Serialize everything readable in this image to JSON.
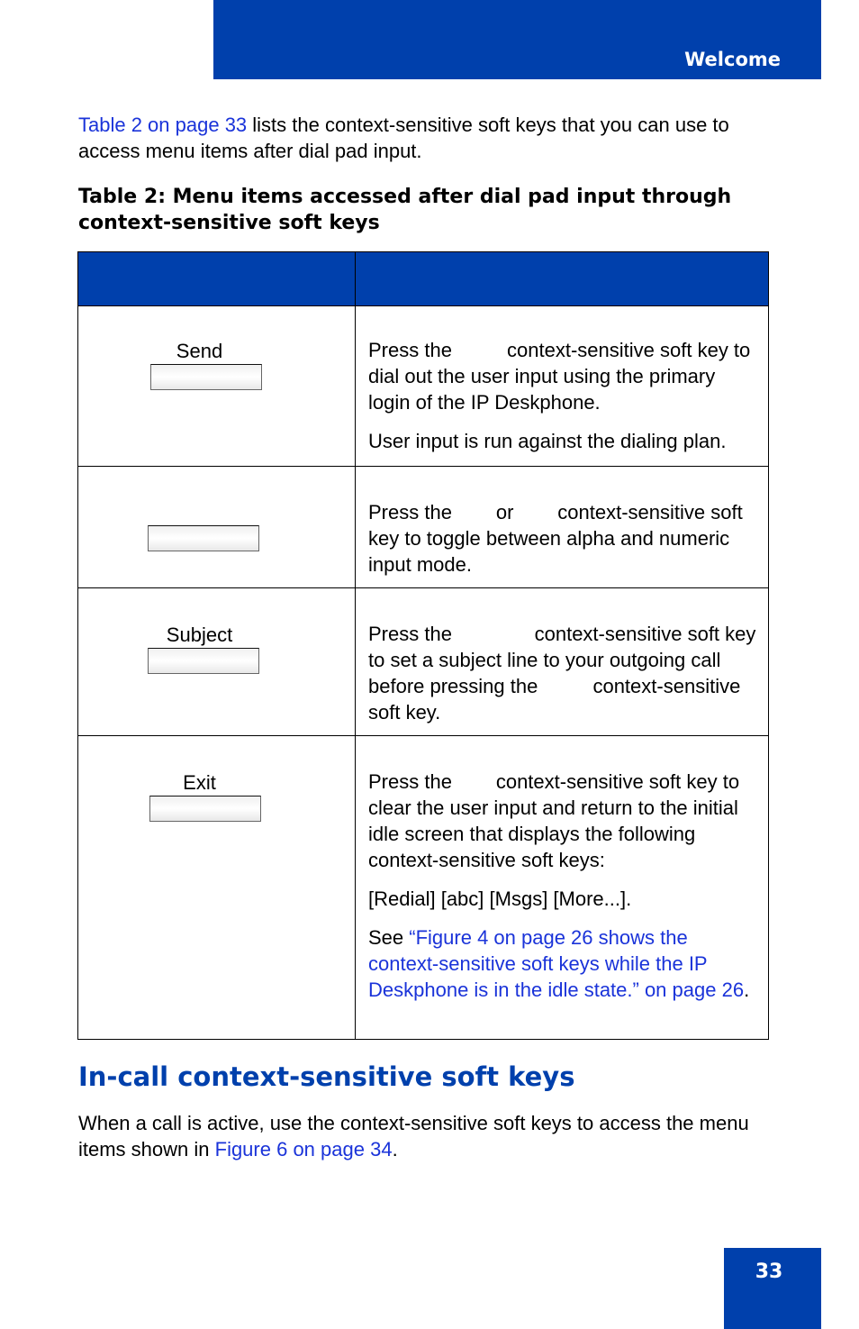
{
  "header": {
    "title": "Welcome"
  },
  "intro": {
    "link": "Table 2 on page 33",
    "text": " lists the context-sensitive soft keys that you can use to access menu items after dial pad input."
  },
  "table_caption": "Table 2: Menu items accessed after dial pad input through context-sensitive soft keys",
  "table": {
    "headers": [
      "",
      ""
    ],
    "rows": [
      {
        "key_label": "Send",
        "desc": [
          "Press the          context-sensitive soft key to dial out the user input using the primary login of the IP Deskphone.",
          "User input is run against the dialing plan."
        ]
      },
      {
        "key_label": "",
        "desc": [
          "Press the        or        context-sensitive soft key to toggle between alpha and numeric input mode."
        ]
      },
      {
        "key_label": "Subject",
        "desc": [
          "Press the               context-sensitive soft key to set a subject line to your outgoing call before pressing the          context-sensitive soft key."
        ]
      },
      {
        "key_label": "Exit",
        "desc": [
          "Press the        context-sensitive soft key to clear the user input and return to the initial idle screen that displays the following context-sensitive soft keys:",
          "[Redial] [abc] [Msgs] [More...]."
        ],
        "see_prefix": "See ",
        "see_link": "“Figure 4 on page 26 shows the context-sensitive soft keys while the IP Deskphone is in the idle state.” on page 26",
        "see_suffix": "."
      }
    ]
  },
  "section": {
    "title": "In-call context-sensitive soft keys",
    "body_prefix": "When a call is active, use the context-sensitive soft keys to access the menu items shown in ",
    "body_link": "Figure 6 on page 34",
    "body_suffix": "."
  },
  "footer": {
    "page_number": "33"
  },
  "colors": {
    "brand_blue": "#0040ac",
    "link_blue": "#1a33d9"
  }
}
